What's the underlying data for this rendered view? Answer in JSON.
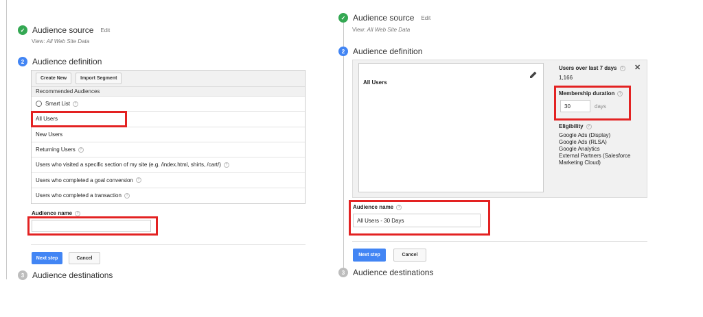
{
  "left": {
    "steps": {
      "source": {
        "title": "Audience source",
        "edit": "Edit",
        "view_prefix": "View:",
        "view_value": "All Web Site Data",
        "number": ""
      },
      "definition": {
        "title": "Audience definition",
        "number": "2"
      },
      "destinations": {
        "title": "Audience destinations",
        "number": "3"
      }
    },
    "toolbar": {
      "create_new": "Create New",
      "import_segment": "Import Segment"
    },
    "recommended_header": "Recommended Audiences",
    "rows": [
      "Smart List",
      "All Users",
      "New Users",
      "Returning Users",
      "Users who visited a specific section of my site (e.g. /index.html, shirts, /cart/)",
      "Users who completed a goal conversion",
      "Users who completed a transaction"
    ],
    "audience_name_label": "Audience name",
    "audience_name_value": "",
    "next_step": "Next step",
    "cancel": "Cancel"
  },
  "right": {
    "steps": {
      "source": {
        "title": "Audience source",
        "edit": "Edit",
        "view_prefix": "View:",
        "view_value": "All Web Site Data"
      },
      "definition": {
        "title": "Audience definition",
        "number": "2"
      },
      "destinations": {
        "title": "Audience destinations",
        "number": "3"
      }
    },
    "card": {
      "selected": "All Users",
      "users_label": "Users over last 7 days",
      "users_count": "1,166",
      "membership_label": "Membership duration",
      "membership_value": "30",
      "membership_unit": "days",
      "eligibility_label": "Eligibility",
      "eligibility_items": [
        "Google Ads (Display)",
        "Google Ads (RLSA)",
        "Google Analytics",
        "External Partners (Salesforce",
        "Marketing Cloud)"
      ]
    },
    "audience_name_label": "Audience name",
    "audience_name_value": "All Users - 30 Days",
    "next_step": "Next step",
    "cancel": "Cancel"
  },
  "icons": {
    "check": "check-icon",
    "help": "help-icon",
    "pencil": "pencil-icon",
    "close": "close-icon",
    "smart_list": "smart-list-icon"
  },
  "colors": {
    "done": "#34a853",
    "active": "#4285f4",
    "todo": "#bdbdbd",
    "highlight": "#e32222",
    "primary_button": "#4285f4"
  }
}
